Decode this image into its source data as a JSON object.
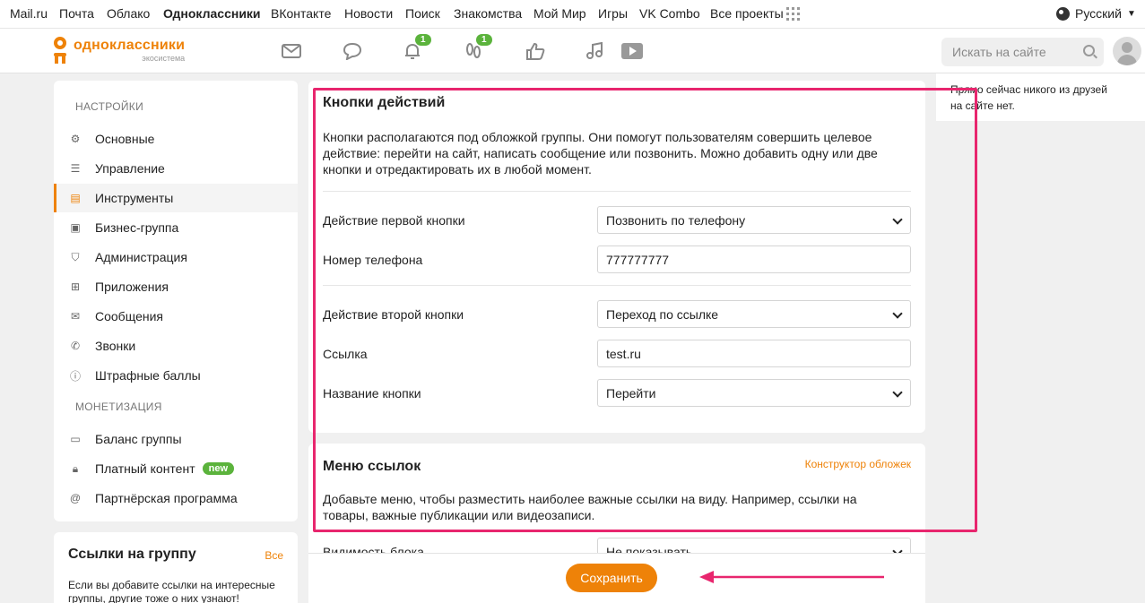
{
  "portal": {
    "links": [
      "Mail.ru",
      "Почта",
      "Облако",
      "Одноклассники",
      "ВКонтакте",
      "Новости",
      "Поиск",
      "Знакомства",
      "Мой Мир",
      "Игры",
      "VK Combo",
      "Все проекты"
    ],
    "language": "Русский"
  },
  "header": {
    "logo_name": "одноклассники",
    "logo_sub": "экосистема",
    "nav_icons": [
      "mail-icon",
      "chat-icon",
      "bell-icon",
      "guests-icon",
      "like-icon",
      "music-icon",
      "video-icon"
    ],
    "notifications_badge": "1",
    "guests_badge": "1",
    "search_placeholder": "Искать на сайте"
  },
  "sidebar": {
    "settings_title": "НАСТРОЙКИ",
    "items": [
      {
        "label": "Основные",
        "icon": "gear-icon"
      },
      {
        "label": "Управление",
        "icon": "sliders-icon"
      },
      {
        "label": "Инструменты",
        "icon": "tools-icon",
        "active": true
      },
      {
        "label": "Бизнес-группа",
        "icon": "briefcase-icon"
      },
      {
        "label": "Администрация",
        "icon": "admin-icon"
      },
      {
        "label": "Приложения",
        "icon": "apps-icon"
      },
      {
        "label": "Сообщения",
        "icon": "envelope-icon"
      },
      {
        "label": "Звонки",
        "icon": "phone-icon"
      },
      {
        "label": "Штрафные баллы",
        "icon": "warning-icon"
      }
    ],
    "monetization_title": "МОНЕТИЗАЦИЯ",
    "monetization_items": [
      {
        "label": "Баланс группы",
        "icon": "wallet-icon"
      },
      {
        "label": "Платный контент",
        "icon": "lock-icon",
        "badge": "new"
      },
      {
        "label": "Партнёрская программа",
        "icon": "at-icon"
      }
    ]
  },
  "links_box": {
    "title": "Ссылки на группу",
    "all": "Все",
    "text": "Если вы добавите ссылки на интересные группы, другие тоже о них узнают!"
  },
  "action_buttons": {
    "title": "Кнопки действий",
    "description": "Кнопки располагаются под обложкой группы. Они помогут пользователям совершить целевое действие: перейти на сайт, написать сообщение или позвонить. Можно добавить одну или две кнопки и отредактировать их в любой момент.",
    "first_action_label": "Действие первой кнопки",
    "first_action_value": "Позвонить по телефону",
    "phone_label": "Номер телефона",
    "phone_value": "777777777",
    "second_action_label": "Действие второй кнопки",
    "second_action_value": "Переход по ссылке",
    "link_label": "Ссылка",
    "link_value": "test.ru",
    "button_name_label": "Название кнопки",
    "button_name_value": "Перейти"
  },
  "link_menu": {
    "title": "Меню ссылок",
    "constructor_link": "Конструктор обложек",
    "description": "Добавьте меню, чтобы разместить наиболее важные ссылки на виду. Например, ссылки на товары, важные публикации или видеозаписи.",
    "visibility_label": "Видимость блока",
    "visibility_value": "Не показывать"
  },
  "save_label": "Сохранить",
  "right_column": {
    "friends_text": "Прямо сейчас никого из друзей на сайте нет."
  },
  "colors": {
    "accent": "#ee8208",
    "badge_green": "#5bb33c",
    "annotation": "#e8266e"
  }
}
